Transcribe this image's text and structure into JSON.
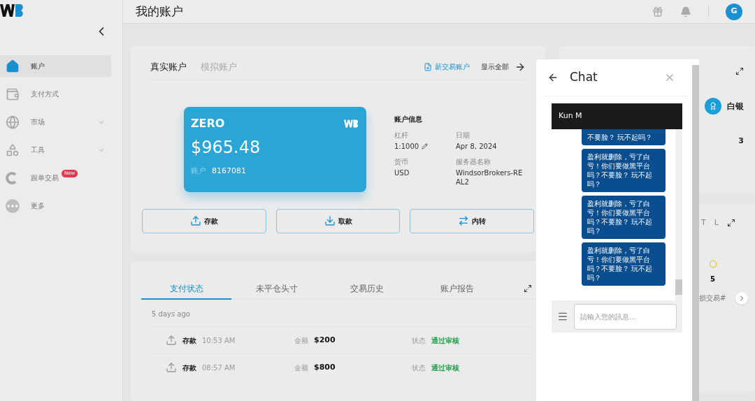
{
  "header": {
    "title": "我的账户",
    "avatar": "G"
  },
  "sidebar": {
    "items": [
      {
        "label": "账户",
        "kind": "home",
        "selected": true,
        "expandable": false
      },
      {
        "label": "支付方式",
        "kind": "wallet",
        "selected": false,
        "expandable": false
      },
      {
        "label": "市场",
        "kind": "globe",
        "selected": false,
        "expandable": true
      },
      {
        "label": "工具",
        "kind": "shapes",
        "selected": false,
        "expandable": true
      },
      {
        "label": "跟单交易",
        "kind": "copy",
        "selected": false,
        "expandable": false,
        "badge": "New"
      },
      {
        "label": "更多",
        "kind": "more",
        "selected": false,
        "expandable": false
      }
    ]
  },
  "accounts": {
    "tabs": [
      {
        "label": "真实账户",
        "selected": true
      },
      {
        "label": "模拟账户",
        "selected": false
      }
    ],
    "new_account": "新交易账户",
    "show_all": "显示全部",
    "card": {
      "brand": "ZERO",
      "balance": "$965.48",
      "account_label": "账户",
      "account_number": "8167081"
    },
    "info_title": "账户信息",
    "info": [
      {
        "label": "杠杆",
        "value": "1:1000",
        "editable": true
      },
      {
        "label": "日期",
        "value": "Apr 8, 2024",
        "editable": false
      },
      {
        "label": "货币",
        "value": "USD",
        "editable": false
      },
      {
        "label": "服务器名称",
        "value": "WindsorBrokers-REAL2",
        "editable": false
      }
    ],
    "actions": [
      {
        "label": "存款",
        "kind": "upload"
      },
      {
        "label": "取款",
        "kind": "download"
      },
      {
        "label": "内转",
        "kind": "transfer"
      }
    ]
  },
  "payments": {
    "tabs": [
      {
        "label": "支付状态",
        "selected": true
      },
      {
        "label": "未平仓头寸",
        "selected": false
      },
      {
        "label": "交易历史",
        "selected": false
      },
      {
        "label": "账户报告",
        "selected": false
      }
    ],
    "group": "5 days ago",
    "rows": [
      {
        "type": "存款",
        "time": "10:53 AM",
        "amount_label": "金额",
        "amount": "$200",
        "status_label": "状态",
        "status": "通过审核"
      },
      {
        "type": "存款",
        "time": "08:57 AM",
        "amount_label": "金额",
        "amount": "$800",
        "status_label": "状态",
        "status": "通过审核"
      }
    ]
  },
  "right": {
    "level": "白银",
    "count": "3",
    "tabs": [
      "T",
      "L"
    ],
    "stat": "5",
    "stat_label": "损交易#"
  },
  "chat": {
    "title": "Chat",
    "contact": "Kun M",
    "messages": [
      {
        "text": "不要脸？ 玩不起吗？"
      },
      {
        "text": "盈利就删除，亏了白亏！你们要做黑平台吗？不要脸？ 玩不起吗？"
      },
      {
        "text": "盈利就删除，亏了白亏！你们要做黑平台吗？不要脸？ 玩不起吗？"
      },
      {
        "text": "盈利就删除，亏了白亏！你们要做黑平台吗？不要脸？ 玩不起吗？"
      }
    ],
    "placeholder": "請輸入您的訊息..."
  }
}
